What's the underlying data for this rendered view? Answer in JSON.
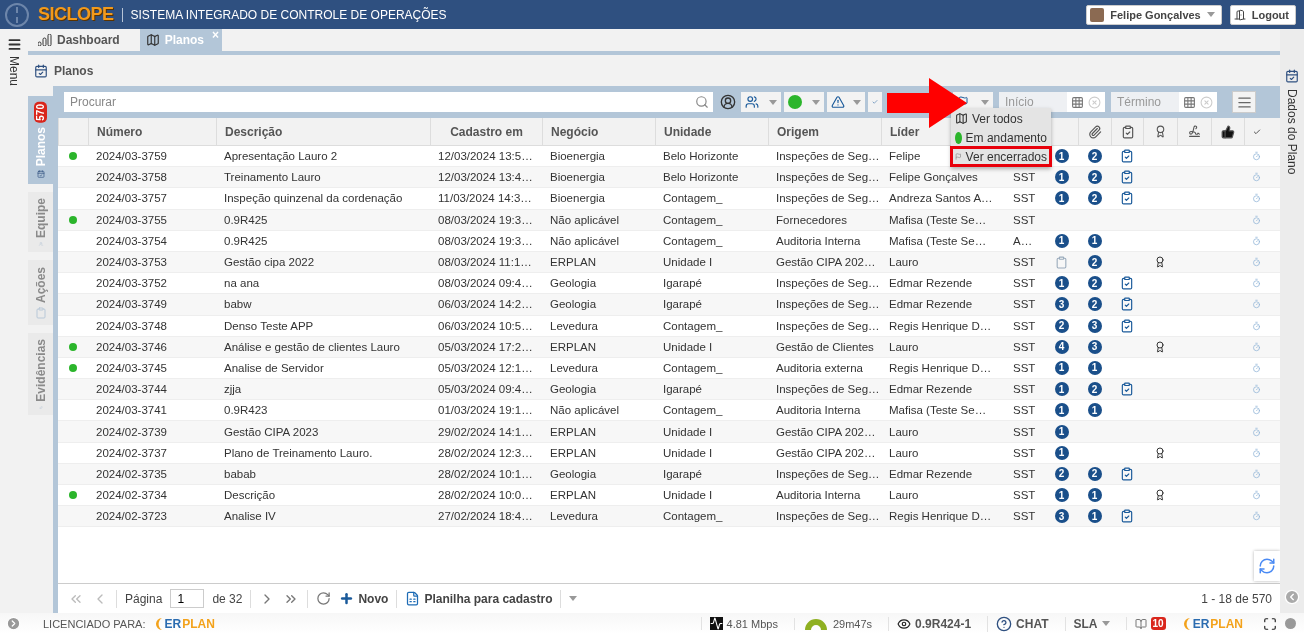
{
  "header": {
    "logo": "SICLOPE",
    "subtitle": "SISTEMA INTEGRADO DE CONTROLE DE OPERAÇÕES",
    "user": "Felipe Gonçalves",
    "logout": "Logout"
  },
  "menu_label": "Menu",
  "tabs": [
    {
      "label": "Dashboard",
      "selected": false
    },
    {
      "label": "Planos",
      "selected": true,
      "close": "×"
    }
  ],
  "page_title": "Planos",
  "side_tabs": [
    {
      "label": "Planos",
      "badge": "570",
      "selected": true
    },
    {
      "label": "Equipe",
      "selected": false
    },
    {
      "label": "Ações",
      "selected": false
    },
    {
      "label": "Evidências",
      "selected": false
    }
  ],
  "right_panel_label": "Dados do Plano",
  "toolbar": {
    "search_placeholder": "Procurar",
    "start_placeholder": "Início",
    "end_placeholder": "Término"
  },
  "dropdown": [
    {
      "label": "Ver todos",
      "kind": "map",
      "highlighted": false
    },
    {
      "label": "Em andamento",
      "kind": "dot",
      "highlighted": false
    },
    {
      "label": "Ver encerrados",
      "kind": "flag",
      "highlighted": true
    }
  ],
  "table": {
    "columns": [
      "Número",
      "Descrição",
      "Cadastro em",
      "Negócio",
      "Unidade",
      "Origem",
      "Líder"
    ],
    "rows": [
      {
        "active": true,
        "number": "2024/03-3759",
        "description": "Apresentação Lauro 2",
        "created": "12/03/2024 13:5…",
        "business": "Bioenergia",
        "unit": "Belo Horizonte",
        "origin": "Inspeções de Seg…",
        "leader": "Felipe",
        "col_10": {
          "kind": "badge",
          "text": "1"
        },
        "col_11": "2",
        "clipboard": true,
        "award": false
      },
      {
        "active": false,
        "number": "2024/03-3758",
        "description": "Treinamento Lauro",
        "created": "12/03/2024 13:4…",
        "business": "Bioenergia",
        "unit": "Belo Horizonte",
        "origin": "Inspeções de Seg…",
        "leader": "Felipe Gonçalves",
        "col_9": "SST",
        "col_10": {
          "kind": "badge",
          "text": "1"
        },
        "col_11": "2",
        "clipboard": true,
        "award": false
      },
      {
        "active": false,
        "number": "2024/03-3757",
        "description": "Inspeção quinzenal da cordenação",
        "created": "11/03/2024 14:3…",
        "business": "Bioenergia",
        "unit": "Contagem_",
        "origin": "Inspeções de Seg…",
        "leader": "Andreza Santos A…",
        "col_9": "SST",
        "col_10": {
          "kind": "badge",
          "text": "1"
        },
        "col_11": "2",
        "clipboard": true,
        "award": false
      },
      {
        "active": true,
        "number": "2024/03-3755",
        "description": "0.9R425",
        "created": "08/03/2024 19:3…",
        "business": "Não aplicável",
        "unit": "Contagem_",
        "origin": "Fornecedores",
        "leader": "Mafisa (Teste Se…",
        "col_9": "SST",
        "clipboard": false,
        "award": false
      },
      {
        "active": false,
        "number": "2024/03-3754",
        "description": "0.9R425",
        "created": "08/03/2024 19:3…",
        "business": "Não aplicável",
        "unit": "Contagem_",
        "origin": "Auditoria Interna",
        "leader": "Mafisa (Teste Se…",
        "col_9": "A…",
        "col_10": {
          "kind": "badge",
          "text": "1"
        },
        "col_11": "1",
        "clipboard": false,
        "award": false
      },
      {
        "active": false,
        "number": "2024/03-3753",
        "description": "Gestão cipa 2022",
        "created": "08/03/2024 11:1…",
        "business": "ERPLAN",
        "unit": "Unidade I",
        "origin": "Gestão CIPA 202…",
        "leader": "Lauro",
        "col_9": "SST",
        "col_10": {
          "kind": "clipboard"
        },
        "col_11": "2",
        "clipboard": false,
        "award": true
      },
      {
        "active": false,
        "number": "2024/03-3752",
        "description": "na ana",
        "created": "08/03/2024 09:4…",
        "business": "Geologia",
        "unit": "Igarapé",
        "origin": "Inspeções de Seg…",
        "leader": "Edmar Rezende",
        "col_9": "SST",
        "col_10": {
          "kind": "badge",
          "text": "1"
        },
        "col_11": "2",
        "clipboard": true,
        "award": false
      },
      {
        "active": false,
        "number": "2024/03-3749",
        "description": "babw",
        "created": "06/03/2024 14:2…",
        "business": "Geologia",
        "unit": "Igarapé",
        "origin": "Inspeções de Seg…",
        "leader": "Edmar Rezende",
        "col_9": "SST",
        "col_10": {
          "kind": "badge",
          "text": "3"
        },
        "col_11": "2",
        "clipboard": true,
        "award": false
      },
      {
        "active": false,
        "number": "2024/03-3748",
        "description": "Denso Teste APP",
        "created": "06/03/2024 10:5…",
        "business": "Levedura",
        "unit": "Contagem_",
        "origin": "Inspeções de Seg…",
        "leader": "Regis Henrique D…",
        "col_9": "SST",
        "col_10": {
          "kind": "badge",
          "text": "2"
        },
        "col_11": "3",
        "clipboard": true,
        "award": false
      },
      {
        "active": true,
        "number": "2024/03-3746",
        "description": "Análise e gestão de clientes Lauro",
        "created": "05/03/2024 17:2…",
        "business": "ERPLAN",
        "unit": "Unidade I",
        "origin": "Gestão de Clientes",
        "leader": "Lauro",
        "col_9": "SST",
        "col_10": {
          "kind": "badge",
          "text": "4"
        },
        "col_11": "3",
        "clipboard": false,
        "award": true
      },
      {
        "active": true,
        "number": "2024/03-3745",
        "description": "Analise de Servidor",
        "created": "05/03/2024 12:1…",
        "business": "Levedura",
        "unit": "Contagem_",
        "origin": "Auditoria externa",
        "leader": "Regis Henrique D…",
        "col_9": "SST",
        "col_10": {
          "kind": "badge",
          "text": "1"
        },
        "col_11": "1",
        "clipboard": false,
        "award": false
      },
      {
        "active": false,
        "number": "2024/03-3744",
        "description": "zjja",
        "created": "05/03/2024 09:4…",
        "business": "Geologia",
        "unit": "Igarapé",
        "origin": "Inspeções de Seg…",
        "leader": "Edmar Rezende",
        "col_9": "SST",
        "col_10": {
          "kind": "badge",
          "text": "1"
        },
        "col_11": "2",
        "clipboard": true,
        "award": false
      },
      {
        "active": false,
        "number": "2024/03-3741",
        "description": "0.9R423",
        "created": "01/03/2024 19:1…",
        "business": "Não aplicável",
        "unit": "Contagem_",
        "origin": "Auditoria Interna",
        "leader": "Mafisa (Teste Se…",
        "col_9": "SST",
        "col_10": {
          "kind": "badge",
          "text": "1"
        },
        "col_11": "1",
        "clipboard": false,
        "award": false
      },
      {
        "active": false,
        "number": "2024/02-3739",
        "description": "Gestão CIPA 2023",
        "created": "29/02/2024 14:1…",
        "business": "ERPLAN",
        "unit": "Unidade I",
        "origin": "Gestão CIPA 202…",
        "leader": "Lauro",
        "col_9": "SST",
        "col_10": {
          "kind": "badge",
          "text": "1"
        },
        "clipboard": false,
        "award": false
      },
      {
        "active": false,
        "number": "2024/02-3737",
        "description": "Plano de Treinamento Lauro.",
        "created": "28/02/2024 12:3…",
        "business": "ERPLAN",
        "unit": "Unidade I",
        "origin": "Gestão CIPA 202…",
        "leader": "Lauro",
        "col_9": "SST",
        "col_10": {
          "kind": "badge",
          "text": "1"
        },
        "clipboard": false,
        "award": true
      },
      {
        "active": false,
        "number": "2024/02-3735",
        "description": "babab",
        "created": "28/02/2024 10:1…",
        "business": "Geologia",
        "unit": "Igarapé",
        "origin": "Inspeções de Seg…",
        "leader": "Edmar Rezende",
        "col_9": "SST",
        "col_10": {
          "kind": "badge",
          "text": "2"
        },
        "col_11": "2",
        "clipboard": true,
        "award": false
      },
      {
        "active": true,
        "number": "2024/02-3734",
        "description": "Descrição",
        "created": "28/02/2024 10:0…",
        "business": "ERPLAN",
        "unit": "Unidade I",
        "origin": "Auditoria Interna",
        "leader": "Lauro",
        "col_9": "SST",
        "col_10": {
          "kind": "badge",
          "text": "1"
        },
        "col_11": "1",
        "clipboard": false,
        "award": true
      },
      {
        "active": false,
        "number": "2024/02-3723",
        "description": "Analise IV",
        "created": "27/02/2024 18:4…",
        "business": "Levedura",
        "unit": "Contagem_",
        "origin": "Inspeções de Seg…",
        "leader": "Regis Henrique D…",
        "col_9": "SST",
        "col_10": {
          "kind": "badge",
          "text": "3"
        },
        "col_11": "1",
        "clipboard": true,
        "award": false
      }
    ]
  },
  "pagination": {
    "page_label": "Página",
    "page": "1",
    "of": "de 32",
    "new": "Novo",
    "spreadsheet": "Planilha para cadastro",
    "range": "1 - 18 de 570"
  },
  "status_bar": {
    "license_label": "LICENCIADO PARA:",
    "logo_left": {
      "part_1": "ER",
      "part_2": "PLAN"
    },
    "speed": "4.81 Mbps",
    "session": "29m47s",
    "version": "0.9R424-1",
    "chat": "CHAT",
    "sla": "SLA",
    "notifications": "10",
    "logo_right": {
      "part_1": "ER",
      "part_2": "PLAN"
    }
  }
}
